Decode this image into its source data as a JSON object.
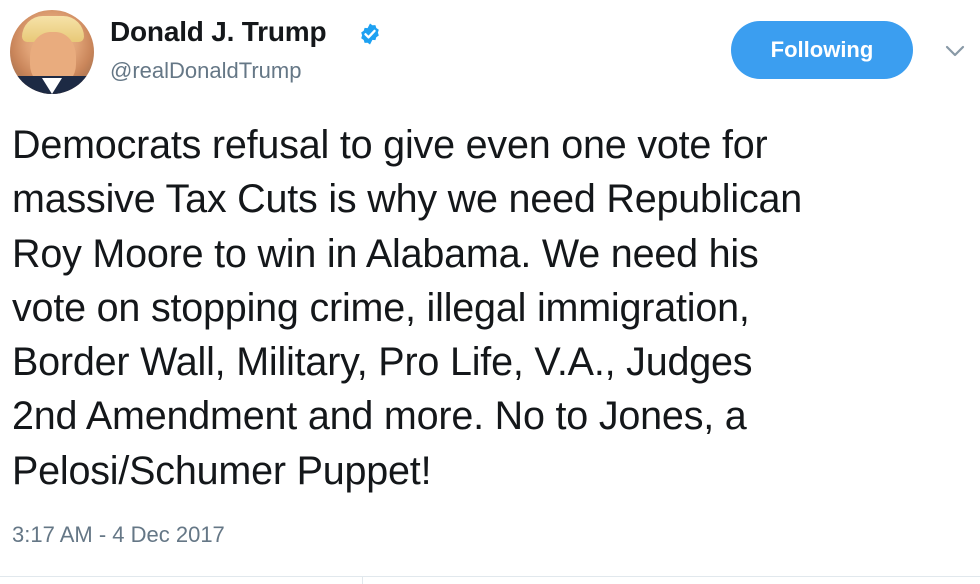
{
  "user": {
    "display_name": "Donald J. Trump",
    "handle": "@realDonaldTrump",
    "verified_icon": "verified-badge-icon"
  },
  "follow_button": {
    "label": "Following"
  },
  "tweet": {
    "text": "Democrats refusal to give even one vote for\nmassive Tax Cuts is why we need Republican\nRoy Moore to win in Alabama. We need his\nvote on stopping crime, illegal immigration,\nBorder Wall, Military, Pro Life, V.A., Judges\n2nd Amendment and more. No to Jones, a\nPelosi/Schumer Puppet!",
    "timestamp": "3:17 AM - 4 Dec 2017"
  },
  "colors": {
    "accent": "#1da1f2",
    "follow_button_bg": "#3b9ef0",
    "secondary_text": "#657786",
    "primary_text": "#14171a"
  }
}
